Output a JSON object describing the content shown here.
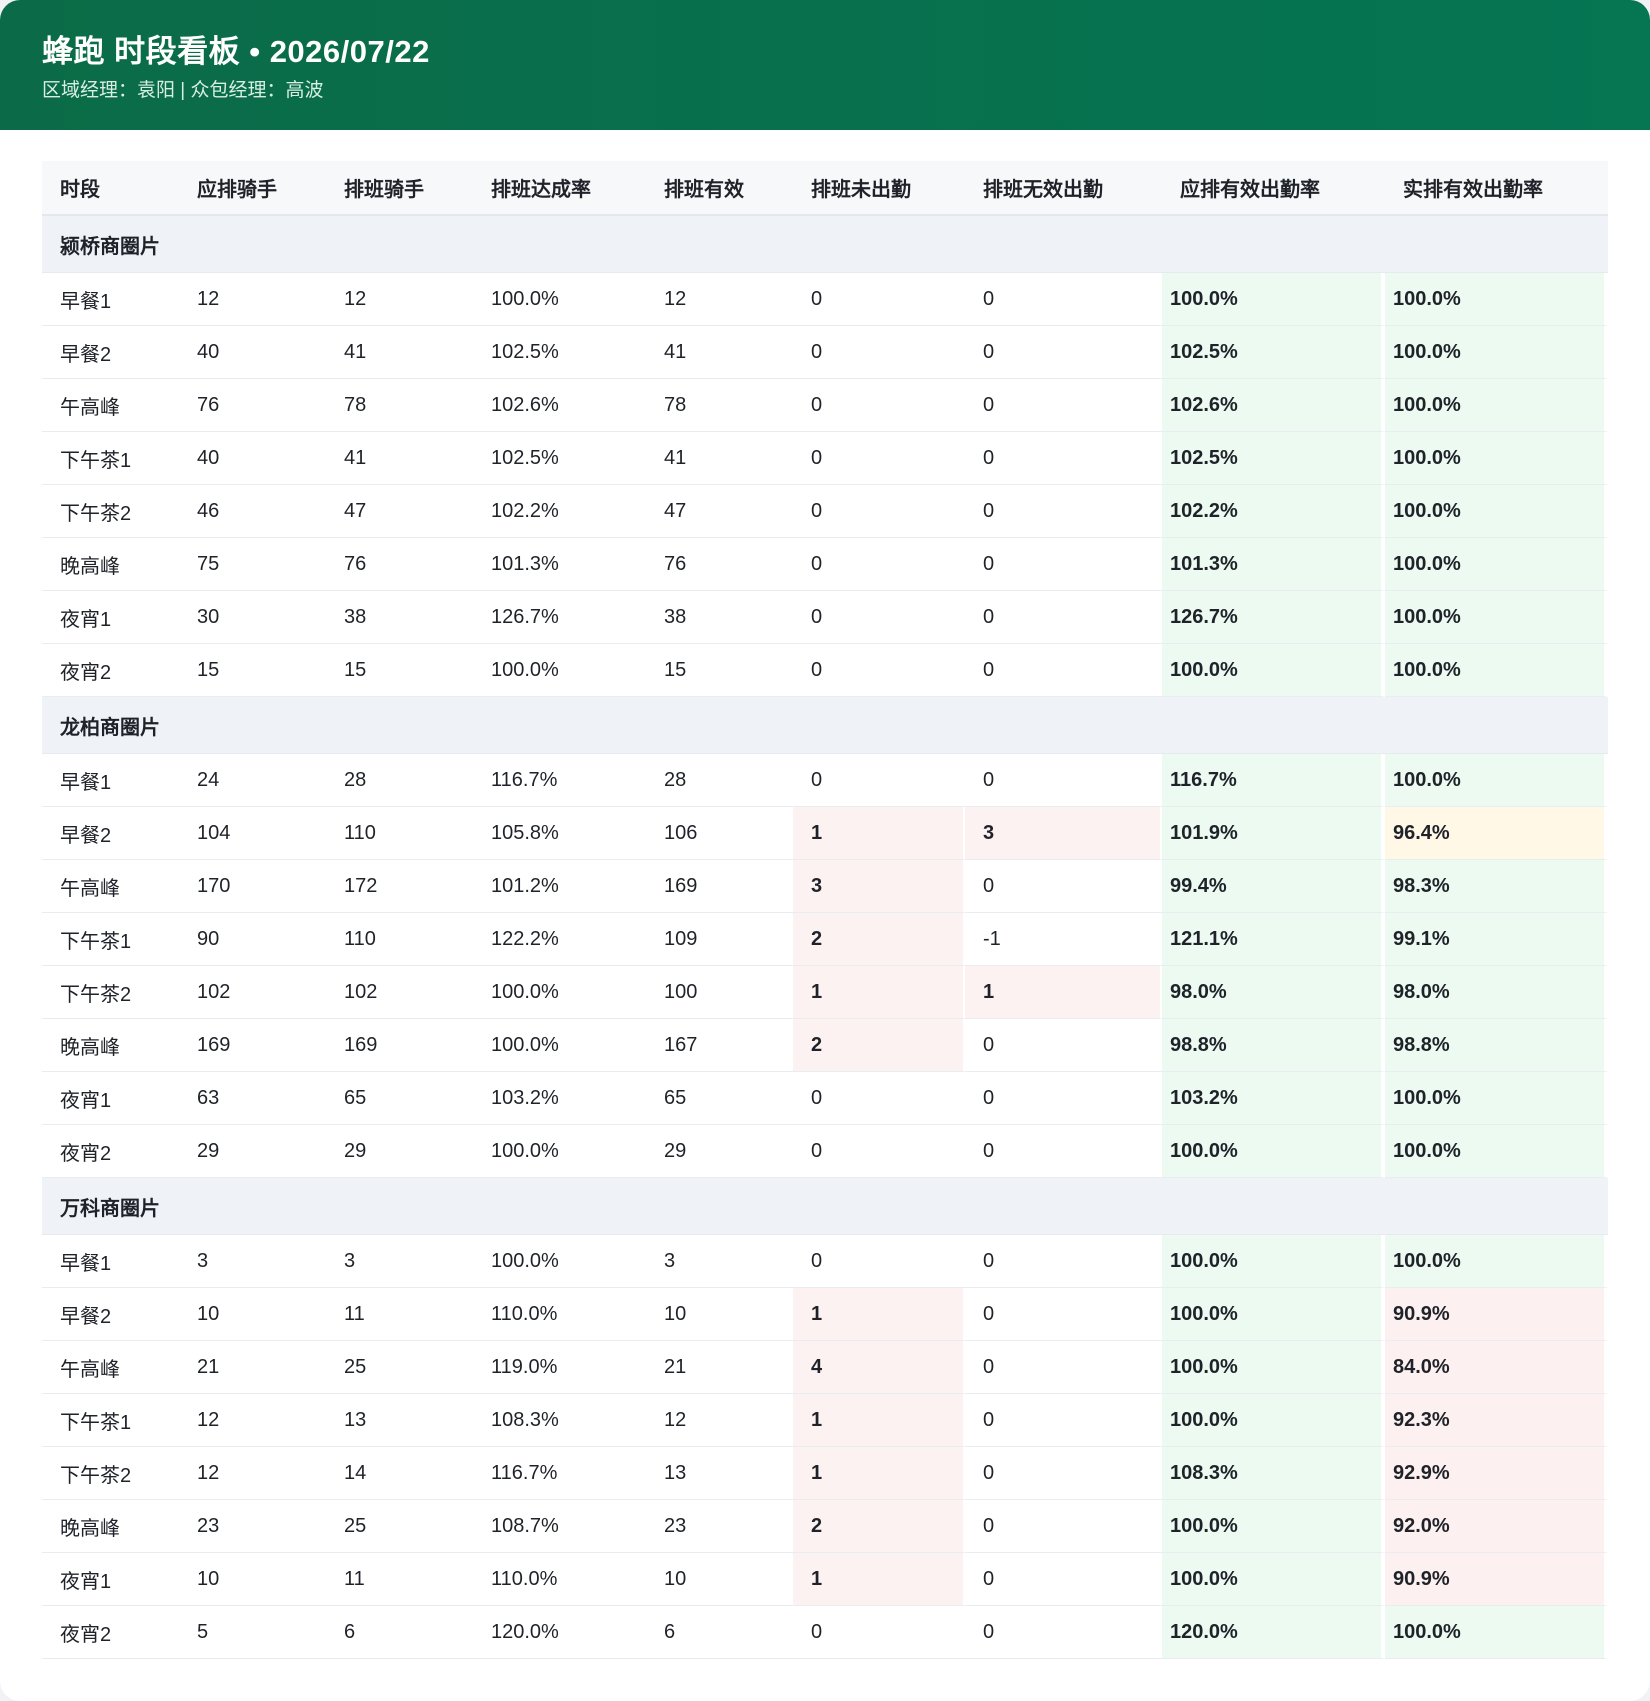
{
  "header": {
    "title": "蜂跑 时段看板 • 2026/07/22",
    "subtitle": "区域经理：袁阳 | 众包经理：高波"
  },
  "colors": {
    "header_bg": "#0b6b48",
    "ok": "#0cad6a",
    "warn": "#e89a0c",
    "bad": "#e54545"
  },
  "columns": [
    "时段",
    "应排骑手",
    "排班骑手",
    "排班达成率",
    "排班有效",
    "排班未出勤",
    "排班无效出勤",
    "应排有效出勤率",
    "实排有效出勤率"
  ],
  "groups": [
    {
      "name": "颍桥商圈片",
      "rows": [
        {
          "slot": "早餐1",
          "planned": "12",
          "scheduled": "12",
          "sched_rate": "100.0%",
          "valid": "12",
          "absent": "0",
          "invalid": "0",
          "plan_rate": "100.0%",
          "actual_rate": "100.0%",
          "actual_status": "ok"
        },
        {
          "slot": "早餐2",
          "planned": "40",
          "scheduled": "41",
          "sched_rate": "102.5%",
          "valid": "41",
          "absent": "0",
          "invalid": "0",
          "plan_rate": "102.5%",
          "actual_rate": "100.0%",
          "actual_status": "ok"
        },
        {
          "slot": "午高峰",
          "planned": "76",
          "scheduled": "78",
          "sched_rate": "102.6%",
          "valid": "78",
          "absent": "0",
          "invalid": "0",
          "plan_rate": "102.6%",
          "actual_rate": "100.0%",
          "actual_status": "ok"
        },
        {
          "slot": "下午茶1",
          "planned": "40",
          "scheduled": "41",
          "sched_rate": "102.5%",
          "valid": "41",
          "absent": "0",
          "invalid": "0",
          "plan_rate": "102.5%",
          "actual_rate": "100.0%",
          "actual_status": "ok"
        },
        {
          "slot": "下午茶2",
          "planned": "46",
          "scheduled": "47",
          "sched_rate": "102.2%",
          "valid": "47",
          "absent": "0",
          "invalid": "0",
          "plan_rate": "102.2%",
          "actual_rate": "100.0%",
          "actual_status": "ok"
        },
        {
          "slot": "晚高峰",
          "planned": "75",
          "scheduled": "76",
          "sched_rate": "101.3%",
          "valid": "76",
          "absent": "0",
          "invalid": "0",
          "plan_rate": "101.3%",
          "actual_rate": "100.0%",
          "actual_status": "ok"
        },
        {
          "slot": "夜宵1",
          "planned": "30",
          "scheduled": "38",
          "sched_rate": "126.7%",
          "valid": "38",
          "absent": "0",
          "invalid": "0",
          "plan_rate": "126.7%",
          "actual_rate": "100.0%",
          "actual_status": "ok"
        },
        {
          "slot": "夜宵2",
          "planned": "15",
          "scheduled": "15",
          "sched_rate": "100.0%",
          "valid": "15",
          "absent": "0",
          "invalid": "0",
          "plan_rate": "100.0%",
          "actual_rate": "100.0%",
          "actual_status": "ok"
        }
      ]
    },
    {
      "name": "龙柏商圈片",
      "rows": [
        {
          "slot": "早餐1",
          "planned": "24",
          "scheduled": "28",
          "sched_rate": "116.7%",
          "valid": "28",
          "absent": "0",
          "invalid": "0",
          "plan_rate": "116.7%",
          "actual_rate": "100.0%",
          "actual_status": "ok"
        },
        {
          "slot": "早餐2",
          "planned": "104",
          "scheduled": "110",
          "sched_rate": "105.8%",
          "valid": "106",
          "absent": "1",
          "invalid": "3",
          "plan_rate": "101.9%",
          "actual_rate": "96.4%",
          "actual_status": "warn"
        },
        {
          "slot": "午高峰",
          "planned": "170",
          "scheduled": "172",
          "sched_rate": "101.2%",
          "valid": "169",
          "absent": "3",
          "invalid": "0",
          "plan_rate": "99.4%",
          "actual_rate": "98.3%",
          "actual_status": "ok"
        },
        {
          "slot": "下午茶1",
          "planned": "90",
          "scheduled": "110",
          "sched_rate": "122.2%",
          "valid": "109",
          "absent": "2",
          "invalid": "-1",
          "plan_rate": "121.1%",
          "actual_rate": "99.1%",
          "actual_status": "ok"
        },
        {
          "slot": "下午茶2",
          "planned": "102",
          "scheduled": "102",
          "sched_rate": "100.0%",
          "valid": "100",
          "absent": "1",
          "invalid": "1",
          "plan_rate": "98.0%",
          "actual_rate": "98.0%",
          "actual_status": "ok"
        },
        {
          "slot": "晚高峰",
          "planned": "169",
          "scheduled": "169",
          "sched_rate": "100.0%",
          "valid": "167",
          "absent": "2",
          "invalid": "0",
          "plan_rate": "98.8%",
          "actual_rate": "98.8%",
          "actual_status": "ok"
        },
        {
          "slot": "夜宵1",
          "planned": "63",
          "scheduled": "65",
          "sched_rate": "103.2%",
          "valid": "65",
          "absent": "0",
          "invalid": "0",
          "plan_rate": "103.2%",
          "actual_rate": "100.0%",
          "actual_status": "ok"
        },
        {
          "slot": "夜宵2",
          "planned": "29",
          "scheduled": "29",
          "sched_rate": "100.0%",
          "valid": "29",
          "absent": "0",
          "invalid": "0",
          "plan_rate": "100.0%",
          "actual_rate": "100.0%",
          "actual_status": "ok"
        }
      ]
    },
    {
      "name": "万科商圈片",
      "rows": [
        {
          "slot": "早餐1",
          "planned": "3",
          "scheduled": "3",
          "sched_rate": "100.0%",
          "valid": "3",
          "absent": "0",
          "invalid": "0",
          "plan_rate": "100.0%",
          "actual_rate": "100.0%",
          "actual_status": "ok"
        },
        {
          "slot": "早餐2",
          "planned": "10",
          "scheduled": "11",
          "sched_rate": "110.0%",
          "valid": "10",
          "absent": "1",
          "invalid": "0",
          "plan_rate": "100.0%",
          "actual_rate": "90.9%",
          "actual_status": "bad"
        },
        {
          "slot": "午高峰",
          "planned": "21",
          "scheduled": "25",
          "sched_rate": "119.0%",
          "valid": "21",
          "absent": "4",
          "invalid": "0",
          "plan_rate": "100.0%",
          "actual_rate": "84.0%",
          "actual_status": "bad"
        },
        {
          "slot": "下午茶1",
          "planned": "12",
          "scheduled": "13",
          "sched_rate": "108.3%",
          "valid": "12",
          "absent": "1",
          "invalid": "0",
          "plan_rate": "100.0%",
          "actual_rate": "92.3%",
          "actual_status": "bad"
        },
        {
          "slot": "下午茶2",
          "planned": "12",
          "scheduled": "14",
          "sched_rate": "116.7%",
          "valid": "13",
          "absent": "1",
          "invalid": "0",
          "plan_rate": "108.3%",
          "actual_rate": "92.9%",
          "actual_status": "bad"
        },
        {
          "slot": "晚高峰",
          "planned": "23",
          "scheduled": "25",
          "sched_rate": "108.7%",
          "valid": "23",
          "absent": "2",
          "invalid": "0",
          "plan_rate": "100.0%",
          "actual_rate": "92.0%",
          "actual_status": "bad"
        },
        {
          "slot": "夜宵1",
          "planned": "10",
          "scheduled": "11",
          "sched_rate": "110.0%",
          "valid": "10",
          "absent": "1",
          "invalid": "0",
          "plan_rate": "100.0%",
          "actual_rate": "90.9%",
          "actual_status": "bad"
        },
        {
          "slot": "夜宵2",
          "planned": "5",
          "scheduled": "6",
          "sched_rate": "120.0%",
          "valid": "6",
          "absent": "0",
          "invalid": "0",
          "plan_rate": "120.0%",
          "actual_rate": "100.0%",
          "actual_status": "ok"
        }
      ]
    }
  ]
}
